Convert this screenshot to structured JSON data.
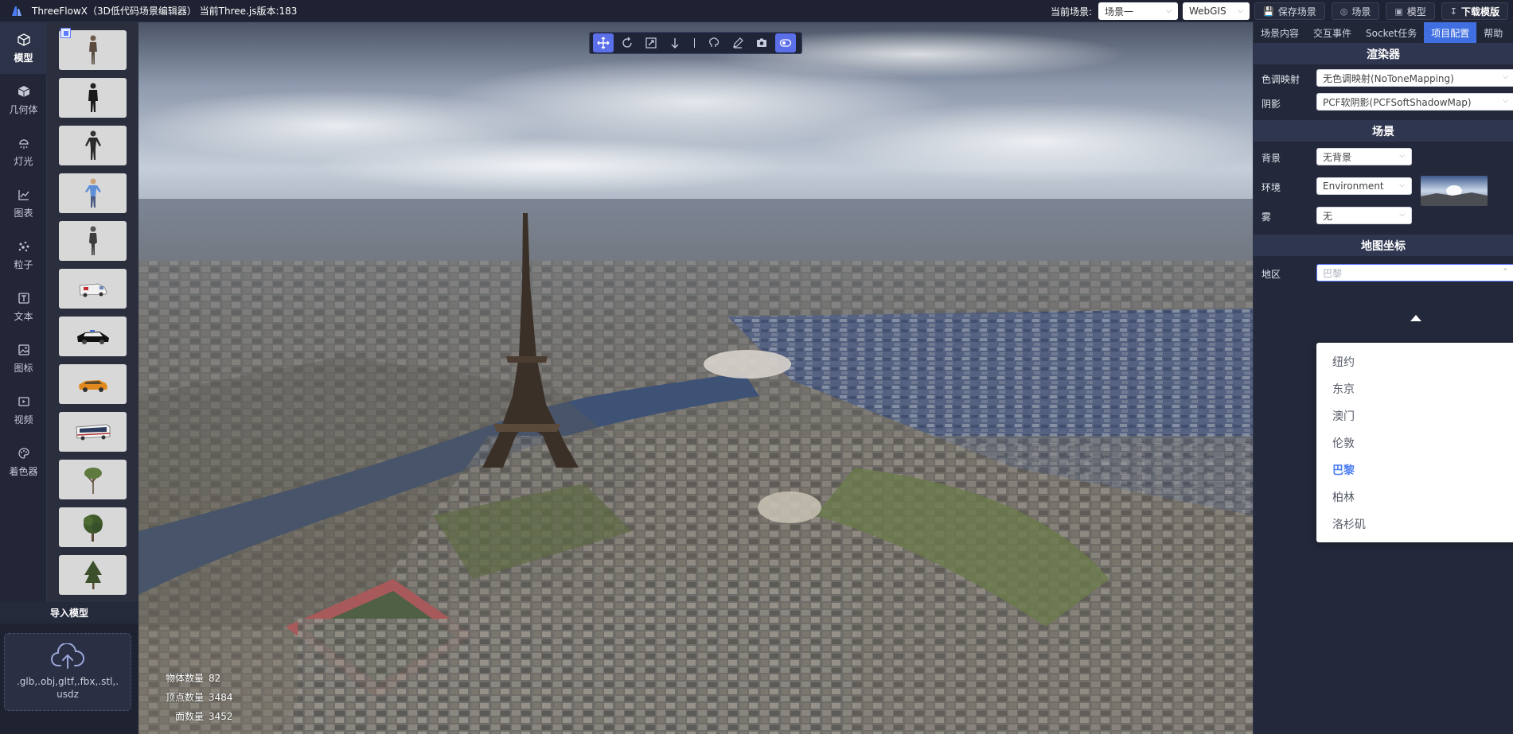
{
  "app": {
    "title": "ThreeFlowX（3D低代码场景编辑器） 当前Three.js版本:183"
  },
  "topbar": {
    "scene_label": "当前场景:",
    "scene_select": "场景一",
    "mode_select": "WebGIS",
    "buttons": [
      {
        "label": "保存场景",
        "icon": "save-icon"
      },
      {
        "label": "场景",
        "icon": "scene-icon"
      },
      {
        "label": "模型",
        "icon": "cube-icon"
      },
      {
        "label": "下载模版",
        "icon": "download-icon"
      }
    ]
  },
  "leftnav": [
    {
      "label": "模型",
      "icon": "cube-outline-icon",
      "active": true
    },
    {
      "label": "几何体",
      "icon": "geometry-icon",
      "active": false
    },
    {
      "label": "灯光",
      "icon": "light-icon",
      "active": false
    },
    {
      "label": "图表",
      "icon": "chart-icon",
      "active": false
    },
    {
      "label": "粒子",
      "icon": "particle-icon",
      "active": false
    },
    {
      "label": "文本",
      "icon": "text-icon",
      "active": false
    },
    {
      "label": "图标",
      "icon": "image-icon",
      "active": false
    },
    {
      "label": "视频",
      "icon": "video-icon",
      "active": false
    },
    {
      "label": "着色器",
      "icon": "shader-icon",
      "active": false
    }
  ],
  "assets": [
    {
      "kind": "person"
    },
    {
      "kind": "person"
    },
    {
      "kind": "person"
    },
    {
      "kind": "person"
    },
    {
      "kind": "person"
    },
    {
      "kind": "ambulance"
    },
    {
      "kind": "police-car"
    },
    {
      "kind": "taxi"
    },
    {
      "kind": "bus"
    },
    {
      "kind": "tree"
    },
    {
      "kind": "tree"
    },
    {
      "kind": "tree"
    }
  ],
  "import": {
    "title": "导入模型",
    "formats": ".glb,.obj,gltf,.fbx,.stl,.usdz"
  },
  "viewport": {
    "tools": [
      {
        "icon": "move-icon",
        "active": true
      },
      {
        "icon": "rotate-icon",
        "active": false
      },
      {
        "icon": "scale-icon",
        "active": false
      },
      {
        "icon": "drop-to-ground-icon",
        "active": false
      },
      {
        "icon": "separator",
        "active": false
      },
      {
        "icon": "brain-icon",
        "active": false
      },
      {
        "icon": "pen-icon",
        "active": false
      },
      {
        "icon": "camera-icon",
        "active": false
      },
      {
        "icon": "toggle-icon",
        "active": true
      }
    ],
    "stats": [
      {
        "label": "物体数量",
        "value": "82"
      },
      {
        "label": "顶点数量",
        "value": "3484"
      },
      {
        "label": "面数量",
        "value": "3452"
      }
    ]
  },
  "rightpanel": {
    "tabs": [
      {
        "label": "场景内容",
        "active": false
      },
      {
        "label": "交互事件",
        "active": false
      },
      {
        "label": "Socket任务",
        "active": false
      },
      {
        "label": "项目配置",
        "active": true
      },
      {
        "label": "帮助",
        "active": false
      }
    ],
    "renderer": {
      "title": "渲染器",
      "tone_label": "色调映射",
      "tone_value": "无色调映射(NoToneMapping)",
      "shadow_label": "阴影",
      "shadow_value": "PCF软阴影(PCFSoftShadowMap)"
    },
    "scene": {
      "title": "场景",
      "bg_label": "背景",
      "bg_value": "无背景",
      "env_label": "环境",
      "env_value": "Environment",
      "fog_label": "雾",
      "fog_value": "无"
    },
    "map": {
      "title": "地图坐标",
      "region_label": "地区",
      "region_placeholder": "巴黎",
      "options": [
        "纽约",
        "东京",
        "澳门",
        "伦敦",
        "巴黎",
        "柏林",
        "洛杉矶"
      ],
      "selected": "巴黎"
    }
  },
  "colors": {
    "accent": "#4a7cf6",
    "tab_active": "#3f6fe0",
    "tool_active": "#5b6fe8",
    "bg": "#1b1e2b"
  }
}
